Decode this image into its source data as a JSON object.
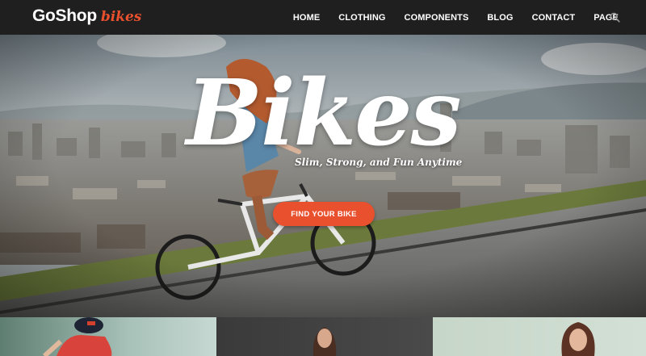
{
  "header": {
    "logo_main": "GoShop",
    "logo_sub": "bikes",
    "nav": [
      "HOME",
      "CLOTHING",
      "COMPONENTS",
      "BLOG",
      "CONTACT",
      "PAGE"
    ],
    "search_icon": "search-icon"
  },
  "hero": {
    "title": "Bikes",
    "tagline": "Slim, Strong, and Fun Anytime",
    "cta_label": "FIND YOUR BIKE"
  },
  "colors": {
    "accent": "#e8502e",
    "header_bg": "#1f1f1f",
    "text_light": "#ffffff"
  }
}
